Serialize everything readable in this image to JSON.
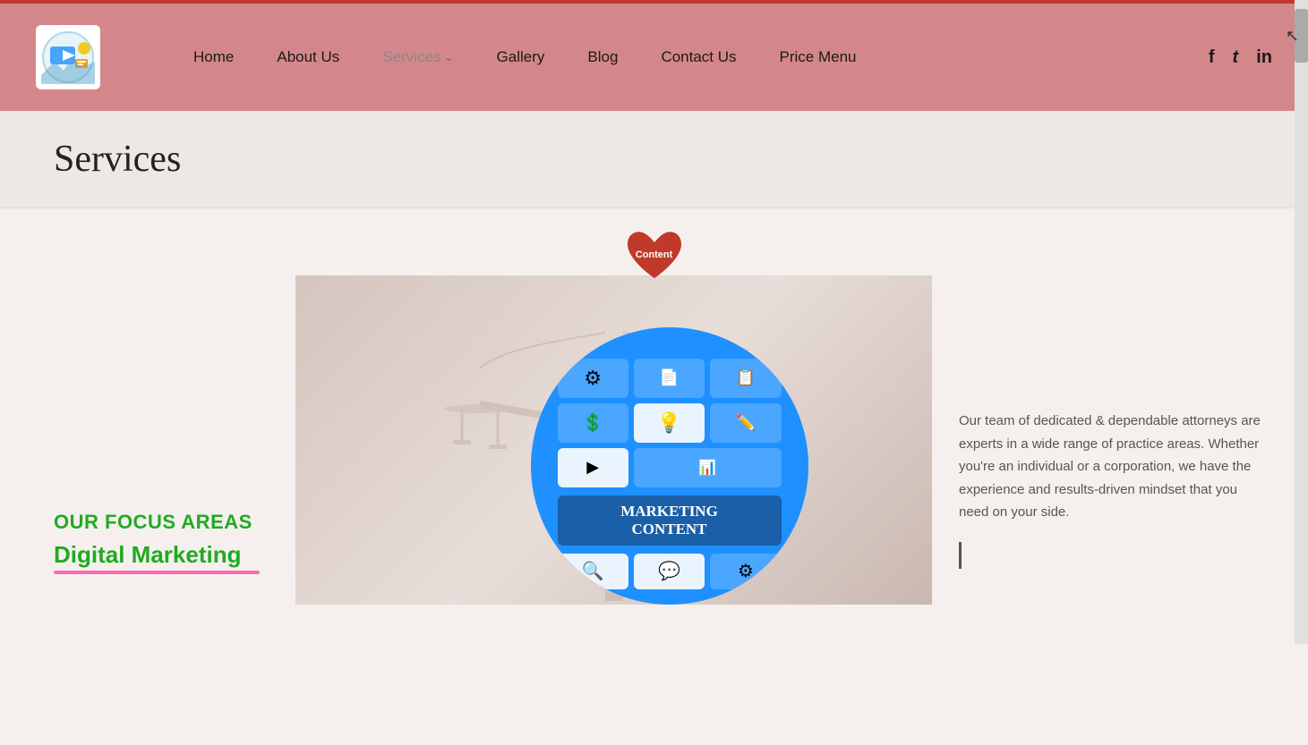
{
  "topBar": {},
  "header": {
    "logo": {
      "alt": "Company Logo"
    },
    "nav": {
      "items": [
        {
          "id": "home",
          "label": "Home",
          "active": false
        },
        {
          "id": "about",
          "label": "About Us",
          "active": false
        },
        {
          "id": "services",
          "label": "Services",
          "active": true,
          "hasDropdown": true
        },
        {
          "id": "gallery",
          "label": "Gallery",
          "active": false
        },
        {
          "id": "blog",
          "label": "Blog",
          "active": false
        },
        {
          "id": "contact",
          "label": "Contact Us",
          "active": false
        },
        {
          "id": "price",
          "label": "Price Menu",
          "active": false
        }
      ]
    },
    "social": {
      "facebook": "f",
      "twitter": "t",
      "linkedin": "in"
    }
  },
  "pageTitleSection": {
    "title": "Services"
  },
  "heartBadge": {
    "label": "Content"
  },
  "leftPanel": {
    "focusLabel": "OUR FOCUS AREAS",
    "focusSub": "Digital Marketing"
  },
  "centerImage": {
    "alt": "Marketing Content Illustration",
    "circleTitle": "MARKETING\nCONTENT"
  },
  "rightPanel": {
    "text": "Our team of dedicated & dependable attorneys are experts in a wide range of practice areas. Whether you're an individual or a corporation, we have the experience and results-driven mindset that you need on your side."
  }
}
